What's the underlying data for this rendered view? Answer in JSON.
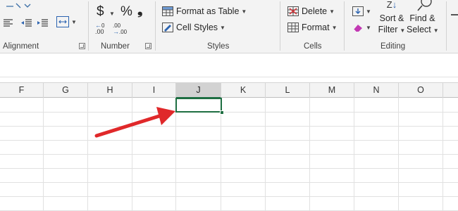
{
  "ribbon": {
    "groups": {
      "alignment": "Alignment",
      "number": "Number",
      "styles": "Styles",
      "cells": "Cells",
      "editing": "Editing"
    },
    "number": {
      "currency": "$",
      "percent": "%",
      "comma": "❟",
      "increase_decimal": ".00",
      "decrease_decimal": ".00"
    },
    "styles": {
      "format_as_table": "Format as Table",
      "cell_styles": "Cell Styles"
    },
    "cells": {
      "delete": "Delete",
      "format": "Format"
    },
    "editing": {
      "sort_filter_top": "Sort &",
      "sort_filter_bottom": "Filter",
      "find_select_top": "Find &",
      "find_select_bottom": "Select"
    }
  },
  "sheet": {
    "columns": [
      "F",
      "G",
      "H",
      "I",
      "J",
      "K",
      "L",
      "M",
      "N",
      "O"
    ],
    "selected_column": "J",
    "active_cell": "J"
  },
  "colors": {
    "accent_green": "#1e6e42",
    "annotation_arrow": "#e0282a"
  }
}
